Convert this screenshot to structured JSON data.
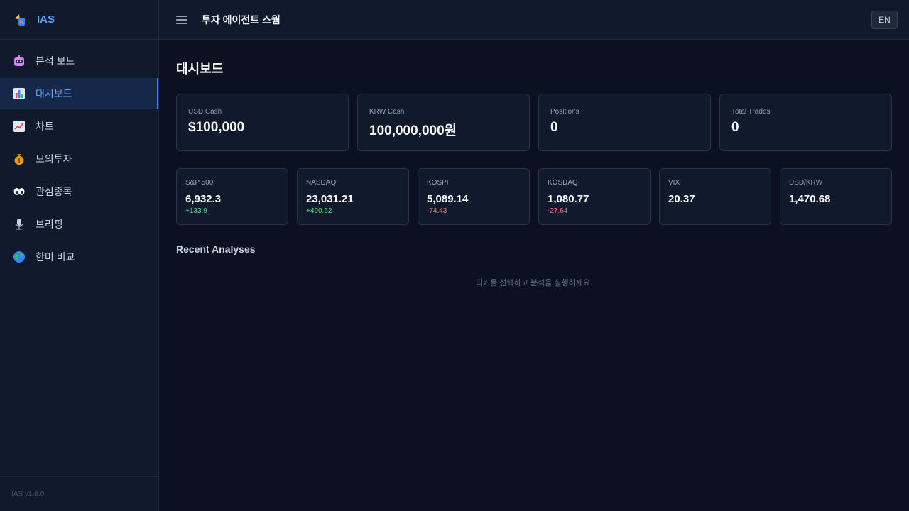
{
  "brand": {
    "name": "IAS"
  },
  "sidebar": {
    "items": [
      {
        "label": "분석 보드",
        "icon": "robot-icon"
      },
      {
        "label": "대시보드",
        "icon": "bar-chart-icon",
        "active": true
      },
      {
        "label": "차트",
        "icon": "trend-chart-icon"
      },
      {
        "label": "모의투자",
        "icon": "money-bag-icon"
      },
      {
        "label": "관심종목",
        "icon": "eyes-icon"
      },
      {
        "label": "브리핑",
        "icon": "microphone-icon"
      },
      {
        "label": "한미 비교",
        "icon": "globe-icon"
      }
    ],
    "version": "IAS v1.0.0"
  },
  "header": {
    "title": "투자 에이전트 스웜",
    "lang_button": "EN"
  },
  "main": {
    "page_title": "대시보드",
    "stats": [
      {
        "label": "USD Cash",
        "value": "$100,000"
      },
      {
        "label": "KRW Cash",
        "value": "100,000,000원"
      },
      {
        "label": "Positions",
        "value": "0"
      },
      {
        "label": "Total Trades",
        "value": "0"
      }
    ],
    "indices": [
      {
        "label": "S&P 500",
        "value": "6,932.3",
        "change": "+133.9",
        "direction": "up"
      },
      {
        "label": "NASDAQ",
        "value": "23,031.21",
        "change": "+490.62",
        "direction": "up"
      },
      {
        "label": "KOSPI",
        "value": "5,089.14",
        "change": "-74.43",
        "direction": "down"
      },
      {
        "label": "KOSDAQ",
        "value": "1,080.77",
        "change": "-27.64",
        "direction": "down"
      },
      {
        "label": "VIX",
        "value": "20.37",
        "change": "",
        "direction": "none"
      },
      {
        "label": "USD/KRW",
        "value": "1,470.68",
        "change": "",
        "direction": "none"
      }
    ],
    "recent_title": "Recent Analyses",
    "empty_message": "티커를 선택하고 분석을 실행하세요."
  },
  "colors": {
    "accent": "#60a5fa",
    "up": "#4ade80",
    "down": "#f87171",
    "background": "#0b1120",
    "panel": "#111a2c"
  }
}
